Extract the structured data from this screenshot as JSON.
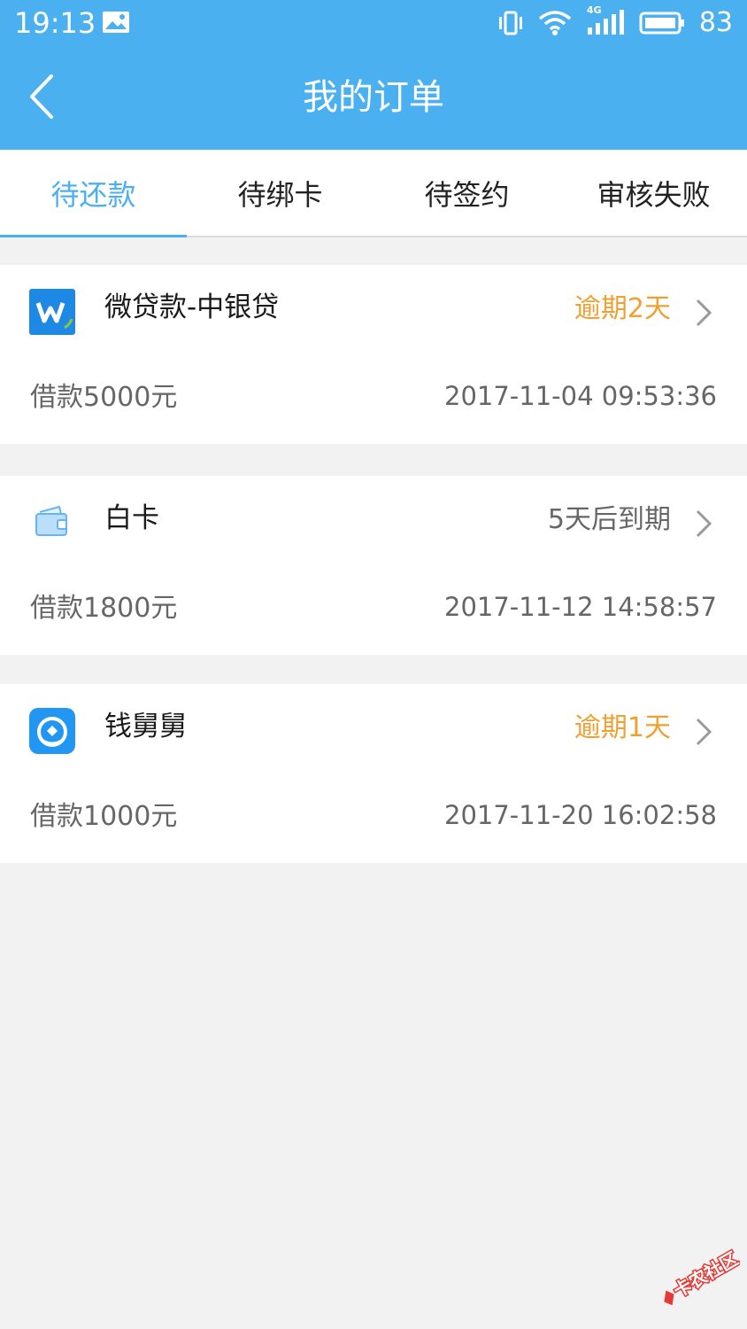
{
  "status_bar": {
    "time": "19:13",
    "network_type": "4G",
    "battery_level": "83"
  },
  "header": {
    "title": "我的订单",
    "back_icon": "chevron-left-icon"
  },
  "tabs": [
    {
      "label": "待还款",
      "active": true
    },
    {
      "label": "待绑卡",
      "active": false
    },
    {
      "label": "待签约",
      "active": false
    },
    {
      "label": "审核失败",
      "active": false
    }
  ],
  "orders": [
    {
      "name": "微贷款-中银贷",
      "status": "逾期2天",
      "status_color": "#f0a030",
      "amount": "借款5000元",
      "datetime": "2017-11-04 09:53:36",
      "icon": "weidaikuan-app-icon"
    },
    {
      "name": "白卡",
      "status": "5天后到期",
      "status_color": "#666666",
      "amount": "借款1800元",
      "datetime": "2017-11-12 14:58:57",
      "icon": "wallet-icon"
    },
    {
      "name": "钱舅舅",
      "status": "逾期1天",
      "status_color": "#f0a030",
      "amount": "借款1000元",
      "datetime": "2017-11-20 16:02:58",
      "icon": "qianjiujiu-app-icon"
    }
  ],
  "watermark": {
    "text": "卡农社区"
  },
  "colors": {
    "accent": "#4bb0f0",
    "overdue": "#f0a030",
    "background": "#f2f2f2"
  }
}
